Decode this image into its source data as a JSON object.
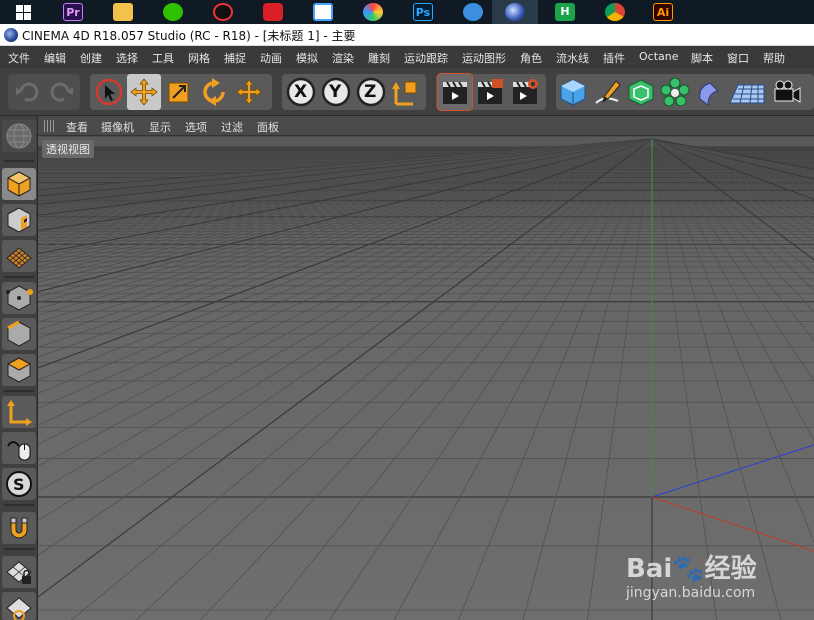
{
  "taskbar": {
    "apps": [
      {
        "name": "windows-start",
        "label": ""
      },
      {
        "name": "premiere-pro",
        "label": "Pr"
      },
      {
        "name": "file-explorer",
        "label": ""
      },
      {
        "name": "wechat",
        "label": ""
      },
      {
        "name": "qq",
        "label": ""
      },
      {
        "name": "creative-cloud",
        "label": ""
      },
      {
        "name": "baidu-netdisk",
        "label": ""
      },
      {
        "name": "app-colored",
        "label": ""
      },
      {
        "name": "photoshop",
        "label": "Ps"
      },
      {
        "name": "blue-bird-app",
        "label": ""
      },
      {
        "name": "cinema4d",
        "label": ""
      },
      {
        "name": "h-app",
        "label": "H"
      },
      {
        "name": "chrome",
        "label": ""
      },
      {
        "name": "illustrator",
        "label": "Ai"
      }
    ]
  },
  "window": {
    "title": "CINEMA 4D R18.057 Studio (RC - R18) - [未标题 1] - 主要"
  },
  "menu": {
    "items": [
      "文件",
      "编辑",
      "创建",
      "选择",
      "工具",
      "网格",
      "捕捉",
      "动画",
      "模拟",
      "渲染",
      "雕刻",
      "运动跟踪",
      "运动图形",
      "角色",
      "流水线",
      "插件",
      "Octane",
      "脚本",
      "窗口",
      "帮助"
    ]
  },
  "toolbar": {
    "axis_x": "X",
    "axis_y": "Y",
    "axis_z": "Z",
    "selected_tool": "move-tool"
  },
  "viewport": {
    "menu_items": [
      "查看",
      "摄像机",
      "显示",
      "选项",
      "过滤",
      "面板"
    ],
    "label": "透视视图"
  },
  "watermark": {
    "brand_text": "Bai🐾经验",
    "url": "jingyan.baidu.com"
  },
  "colors": {
    "taskbar_bg": "#0f1a24",
    "ui_dark": "#404040",
    "tool_orange": "#f0a020",
    "axis_green": "#3aa046",
    "axis_red": "#c03a2a",
    "axis_blue": "#2a3fd0"
  }
}
